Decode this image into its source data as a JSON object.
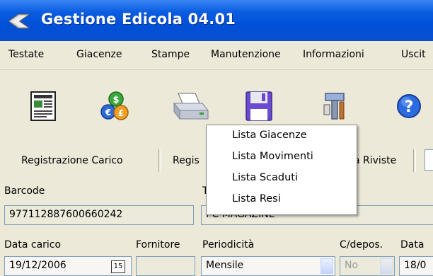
{
  "window": {
    "title": "Gestione Edicola 04.01"
  },
  "menu": [
    "Testate",
    "Giacenze",
    "Stampe",
    "Manutenzione",
    "Informazioni",
    "Uscit"
  ],
  "toolbar": {
    "icons": [
      "newspaper-icon",
      "coins-icon",
      "printer-icon",
      "floppy-disk-icon",
      "tools-icon",
      "help-icon"
    ]
  },
  "buttons": {
    "registrazione_carico": "Registrazione Carico",
    "regis_partial": "Regis",
    "riviste_partial": "a Riviste"
  },
  "popup": {
    "items": [
      "Lista Giacenze",
      "Lista Movimenti",
      "Lista Scaduti",
      "Lista Resi"
    ]
  },
  "form": {
    "barcode_label": "Barcode",
    "t_label_partial": "T",
    "barcode_value": "977112887600660242",
    "title_value_partial": "PC MAGAZINE",
    "data_carico_label": "Data carico",
    "fornitore_label": "Fornitore",
    "periodicita_label": "Periodicità",
    "cdepos_label": "C/depos.",
    "data_label_partial": "Data",
    "data_carico_value": "19/12/2006",
    "calendar_glyph": "15",
    "periodicita_value": "Mensile",
    "cdepos_value": "No",
    "data_value_partial": "18/0"
  }
}
